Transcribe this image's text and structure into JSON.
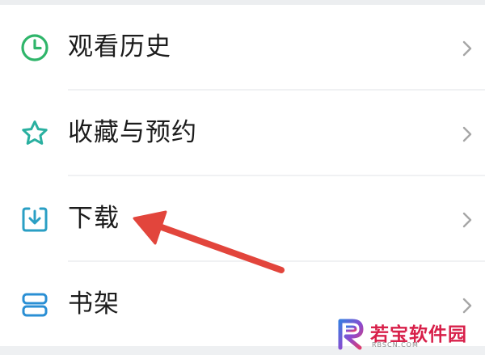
{
  "menu": {
    "items": [
      {
        "label": "观看历史",
        "icon": "clock-icon",
        "icon_color": "#2fb56a"
      },
      {
        "label": "收藏与预约",
        "icon": "star-icon",
        "icon_color": "#2ab0a0"
      },
      {
        "label": "下载",
        "icon": "download-icon",
        "icon_color": "#2a9fc4"
      },
      {
        "label": "书架",
        "icon": "bookshelf-icon",
        "icon_color": "#2a8fd4"
      }
    ],
    "chevron_color": "#a6a6a6",
    "text_color": "#1c1c1c"
  },
  "annotation": {
    "arrow_color": "#e2453c",
    "points_to": "下载"
  },
  "watermark": {
    "name": "若宝软件园",
    "domain": "RBSCN.COM",
    "color": "#d8204a"
  }
}
